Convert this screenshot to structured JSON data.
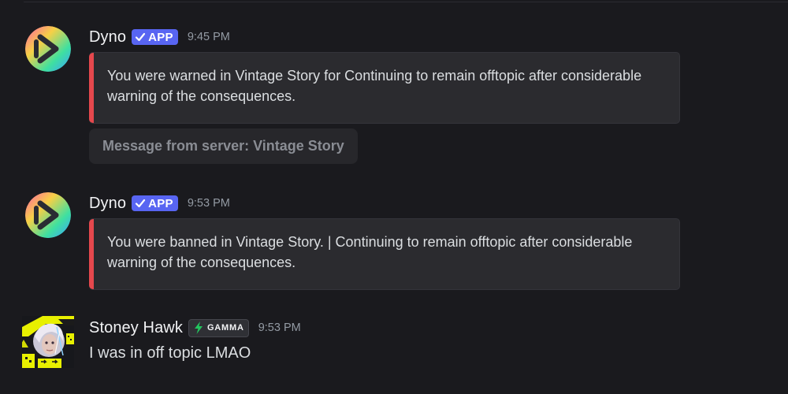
{
  "messages": [
    {
      "username": "Dyno",
      "badge": "APP",
      "time": "9:45 PM",
      "embed_text": "You were warned in Vintage Story for Continuing to remain offtopic after considerable warning of the consequences.",
      "avatar": "dyno-logo-icon",
      "embed_color": "#e5484d"
    },
    {
      "username": "Dyno",
      "badge": "APP",
      "time": "9:53 PM",
      "embed_text": "You were banned in Vintage Story. | Continuing to remain offtopic after considerable warning of the consequences.",
      "avatar": "dyno-logo-icon",
      "embed_color": "#e5484d"
    },
    {
      "username": "Stoney Hawk",
      "badge": "GAMMA",
      "time": "9:53 PM",
      "content": "I was in off topic LMAO",
      "avatar": "user-avatar"
    }
  ],
  "server_note": "Message from server: Vintage Story",
  "colors": {
    "background": "#1a1a1e",
    "embed_background": "#2b2b2f",
    "app_badge": "#5865f2",
    "accent_green": "#22c55e",
    "avatar_yellow": "#e8f000"
  }
}
